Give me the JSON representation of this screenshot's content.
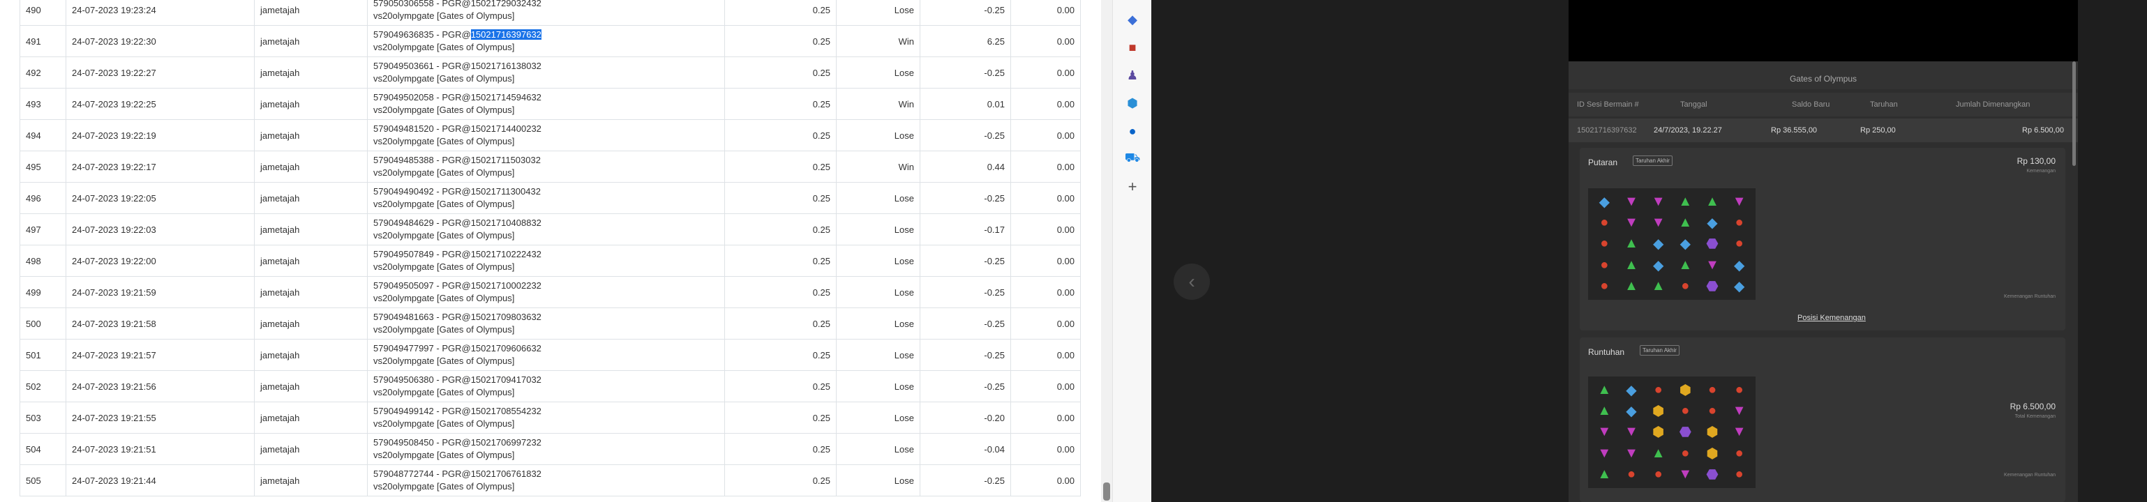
{
  "rows": [
    {
      "no": "490",
      "date": "24-07-2023 19:23:24",
      "user": "jametajah",
      "ref_pre": "579050306558 - PGR@",
      "ref_id": "15021729032432",
      "ref_post": "",
      "game": "vs20olympgate [Gates of Olympus]",
      "bet": "0.25",
      "result": "Lose",
      "amount": "-0.25",
      "balance": "0.00"
    },
    {
      "no": "491",
      "date": "24-07-2023 19:22:30",
      "user": "jametajah",
      "ref_pre": "579049636835 - PGR@",
      "ref_id": "",
      "ref_post": "15021716397632",
      "game": "vs20olympgate [Gates of Olympus]",
      "bet": "0.25",
      "result": "Win",
      "amount": "6.25",
      "balance": "0.00"
    },
    {
      "no": "492",
      "date": "24-07-2023 19:22:27",
      "user": "jametajah",
      "ref_pre": "579049503661 - PGR@",
      "ref_id": "15021716138032",
      "ref_post": "",
      "game": "vs20olympgate [Gates of Olympus]",
      "bet": "0.25",
      "result": "Lose",
      "amount": "-0.25",
      "balance": "0.00"
    },
    {
      "no": "493",
      "date": "24-07-2023 19:22:25",
      "user": "jametajah",
      "ref_pre": "579049502058 - PGR@",
      "ref_id": "15021714594632",
      "ref_post": "",
      "game": "vs20olympgate [Gates of Olympus]",
      "bet": "0.25",
      "result": "Win",
      "amount": "0.01",
      "balance": "0.00"
    },
    {
      "no": "494",
      "date": "24-07-2023 19:22:19",
      "user": "jametajah",
      "ref_pre": "579049481520 - PGR@",
      "ref_id": "15021714400232",
      "ref_post": "",
      "game": "vs20olympgate [Gates of Olympus]",
      "bet": "0.25",
      "result": "Lose",
      "amount": "-0.25",
      "balance": "0.00"
    },
    {
      "no": "495",
      "date": "24-07-2023 19:22:17",
      "user": "jametajah",
      "ref_pre": "579049485388 - PGR@",
      "ref_id": "15021711503032",
      "ref_post": "",
      "game": "vs20olympgate [Gates of Olympus]",
      "bet": "0.25",
      "result": "Win",
      "amount": "0.44",
      "balance": "0.00"
    },
    {
      "no": "496",
      "date": "24-07-2023 19:22:05",
      "user": "jametajah",
      "ref_pre": "579049490492 - PGR@",
      "ref_id": "15021711300432",
      "ref_post": "",
      "game": "vs20olympgate [Gates of Olympus]",
      "bet": "0.25",
      "result": "Lose",
      "amount": "-0.25",
      "balance": "0.00"
    },
    {
      "no": "497",
      "date": "24-07-2023 19:22:03",
      "user": "jametajah",
      "ref_pre": "579049484629 - PGR@",
      "ref_id": "15021710408832",
      "ref_post": "",
      "game": "vs20olympgate [Gates of Olympus]",
      "bet": "0.25",
      "result": "Lose",
      "amount": "-0.17",
      "balance": "0.00"
    },
    {
      "no": "498",
      "date": "24-07-2023 19:22:00",
      "user": "jametajah",
      "ref_pre": "579049507849 - PGR@",
      "ref_id": "15021710222432",
      "ref_post": "",
      "game": "vs20olympgate [Gates of Olympus]",
      "bet": "0.25",
      "result": "Lose",
      "amount": "-0.25",
      "balance": "0.00"
    },
    {
      "no": "499",
      "date": "24-07-2023 19:21:59",
      "user": "jametajah",
      "ref_pre": "579049505097 - PGR@",
      "ref_id": "15021710002232",
      "ref_post": "",
      "game": "vs20olympgate [Gates of Olympus]",
      "bet": "0.25",
      "result": "Lose",
      "amount": "-0.25",
      "balance": "0.00"
    },
    {
      "no": "500",
      "date": "24-07-2023 19:21:58",
      "user": "jametajah",
      "ref_pre": "579049481663 - PGR@",
      "ref_id": "15021709803632",
      "ref_post": "",
      "game": "vs20olympgate [Gates of Olympus]",
      "bet": "0.25",
      "result": "Lose",
      "amount": "-0.25",
      "balance": "0.00"
    },
    {
      "no": "501",
      "date": "24-07-2023 19:21:57",
      "user": "jametajah",
      "ref_pre": "579049477997 - PGR@",
      "ref_id": "15021709606632",
      "ref_post": "",
      "game": "vs20olympgate [Gates of Olympus]",
      "bet": "0.25",
      "result": "Lose",
      "amount": "-0.25",
      "balance": "0.00"
    },
    {
      "no": "502",
      "date": "24-07-2023 19:21:56",
      "user": "jametajah",
      "ref_pre": "579049506380 - PGR@",
      "ref_id": "15021709417032",
      "ref_post": "",
      "game": "vs20olympgate [Gates of Olympus]",
      "bet": "0.25",
      "result": "Lose",
      "amount": "-0.25",
      "balance": "0.00"
    },
    {
      "no": "503",
      "date": "24-07-2023 19:21:55",
      "user": "jametajah",
      "ref_pre": "579049499142 - PGR@",
      "ref_id": "15021708554232",
      "ref_post": "",
      "game": "vs20olympgate [Gates of Olympus]",
      "bet": "0.25",
      "result": "Lose",
      "amount": "-0.20",
      "balance": "0.00"
    },
    {
      "no": "504",
      "date": "24-07-2023 19:21:51",
      "user": "jametajah",
      "ref_pre": "579049508450 - PGR@",
      "ref_id": "15021706997232",
      "ref_post": "",
      "game": "vs20olympgate [Gates of Olympus]",
      "bet": "0.25",
      "result": "Lose",
      "amount": "-0.04",
      "balance": "0.00"
    },
    {
      "no": "505",
      "date": "24-07-2023 19:21:44",
      "user": "jametajah",
      "ref_pre": "579048772744 - PGR@",
      "ref_id": "15021706761832",
      "ref_post": "",
      "game": "vs20olympgate [Gates of Olympus]",
      "bet": "0.25",
      "result": "Lose",
      "amount": "-0.25",
      "balance": "0.00"
    }
  ],
  "colors": {
    "win": "#28a745",
    "lose": "#dc3545",
    "highlight": "#1a73e8",
    "viewer_bg": "#1e1e1e"
  },
  "edge_icons": [
    "tag-icon",
    "toolbox-icon",
    "chess-icon",
    "m365-icon",
    "outlook-icon",
    "shopping-icon",
    "plus-icon"
  ],
  "viewer": {
    "game_title": "Gates of Olympus",
    "headers": [
      "ID Sesi Bermain #",
      "Tanggal",
      "Saldo Baru",
      "Taruhan",
      "Jumlah Dimenangkan"
    ],
    "row": [
      "15021716397632",
      "24/7/2023, 19.22.27",
      "Rp 36.555,00",
      "Rp 250,00",
      "Rp 6.500,00"
    ],
    "spin": {
      "title": "Putaran",
      "badge": "Taruhan Akhir",
      "amount": "Rp 130,00",
      "sub": "Kemenangan",
      "link": "Posisi Kemenangan",
      "note": "Kemenangan Runtuhan"
    },
    "tumble": {
      "title": "Runtuhan",
      "badge": "Taruhan Akhir",
      "amount": "Rp 6.500,00",
      "sub": "Total Kemenangan",
      "note": "Kemenangan Runtuhan"
    }
  }
}
